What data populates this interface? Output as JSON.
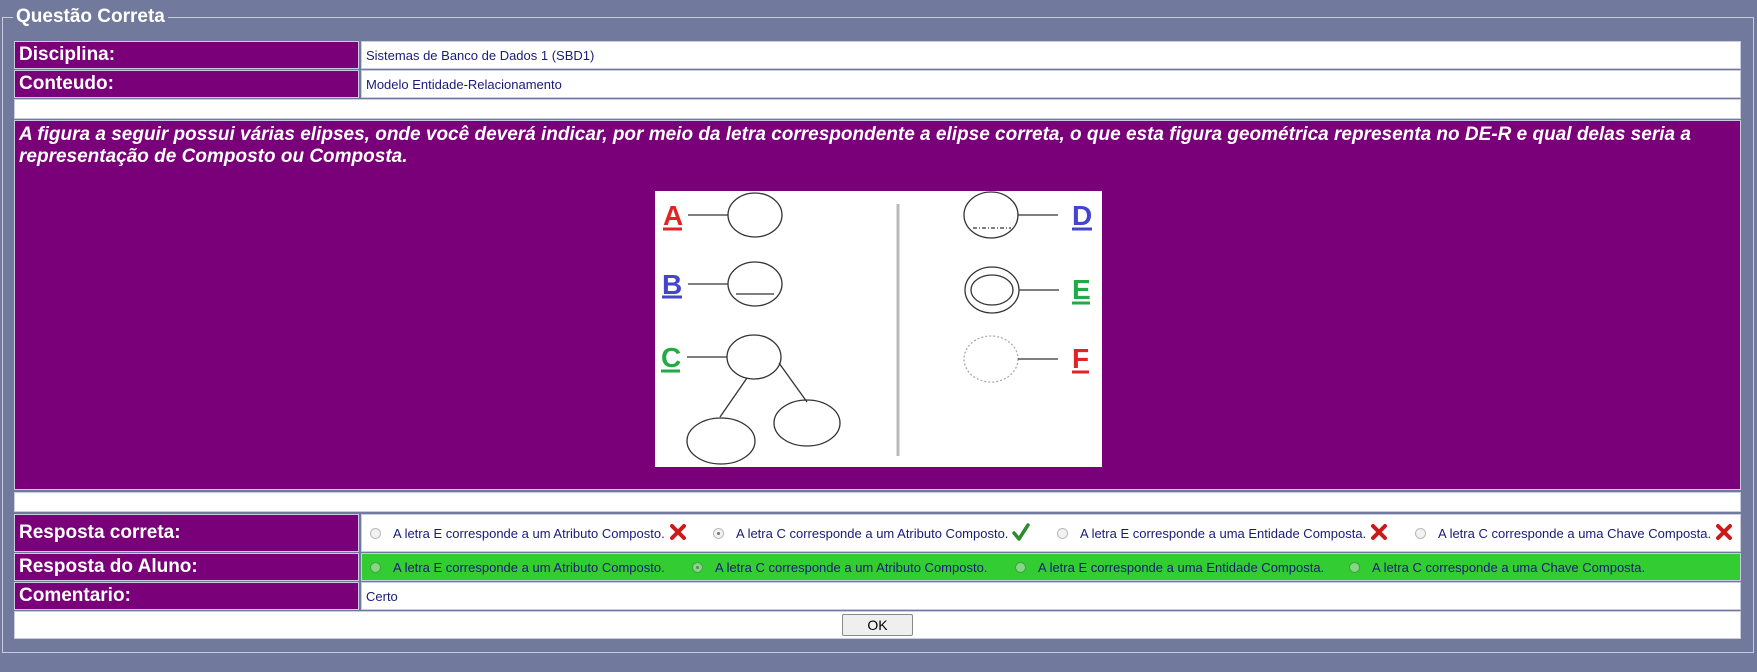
{
  "panel": {
    "title": "Questão Correta"
  },
  "disciplina": {
    "label": "Disciplina:",
    "value": "Sistemas de Banco de Dados 1 (SBD1)"
  },
  "conteudo": {
    "label": "Conteudo:",
    "value": "Modelo Entidade-Relacionamento"
  },
  "question": {
    "text": "A figura a seguir possui várias elipses, onde você deverá indicar, por meio da letra correspondente a elipse correta, o que esta figura geométrica representa no DE-R e qual delas seria a representação de Composto ou Composta.",
    "figure_letters": [
      "A",
      "B",
      "C",
      "D",
      "E",
      "F"
    ]
  },
  "resposta_correta": {
    "label": "Resposta correta:",
    "options": [
      {
        "text": "A letra E corresponde a um Atributo Composto.",
        "checked": false,
        "mark": "wrong"
      },
      {
        "text": "A letra C corresponde a um Atributo Composto.",
        "checked": true,
        "mark": "right"
      },
      {
        "text": "A letra E corresponde a uma Entidade Composta.",
        "checked": false,
        "mark": "wrong"
      },
      {
        "text": "A letra C corresponde a uma Chave Composta.",
        "checked": false,
        "mark": "wrong"
      }
    ]
  },
  "resposta_aluno": {
    "label": "Resposta do Aluno:",
    "options": [
      {
        "text": "A letra E corresponde a um Atributo Composto.",
        "checked": false
      },
      {
        "text": "A letra C corresponde a um Atributo Composto.",
        "checked": true
      },
      {
        "text": "A letra E corresponde a uma Entidade Composta.",
        "checked": false
      },
      {
        "text": "A letra C corresponde a uma Chave Composta.",
        "checked": false
      }
    ],
    "background_color": "#33cc33"
  },
  "comentario": {
    "label": "Comentario:",
    "value": "Certo"
  },
  "ok_button": "OK",
  "colors": {
    "label_bg": "#7a0079",
    "page_bg": "#717a9c",
    "correct_mark": "#2e8b2e",
    "wrong_mark": "#cc1a1a"
  }
}
